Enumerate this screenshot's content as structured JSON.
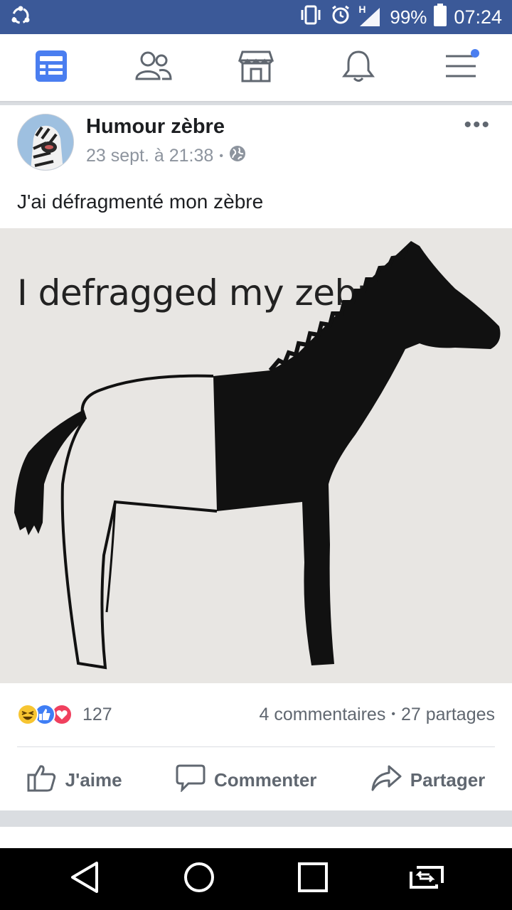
{
  "status_bar": {
    "battery": "99%",
    "time": "07:24",
    "signal_label": "H"
  },
  "navbar": {
    "items": [
      "news-feed",
      "friends",
      "marketplace",
      "notifications",
      "menu"
    ]
  },
  "post": {
    "page_name": "Humour zèbre",
    "timestamp": "23 sept. à 21:38",
    "separator": "•",
    "text": "J'ai défragmenté mon zèbre",
    "image_caption": "I defragged my zebra",
    "more": "•••",
    "reaction_count": "127",
    "comments": "4 commentaires",
    "shares": "27 partages",
    "actions": {
      "like": "J'aime",
      "comment": "Commenter",
      "share": "Partager"
    }
  },
  "colors": {
    "brand": "#3b5998",
    "accent": "#4a7ef0",
    "text_secondary": "#606770",
    "like_blue": "#3f7ef5",
    "love_red": "#f0405e",
    "haha_yellow": "#f7c531"
  }
}
